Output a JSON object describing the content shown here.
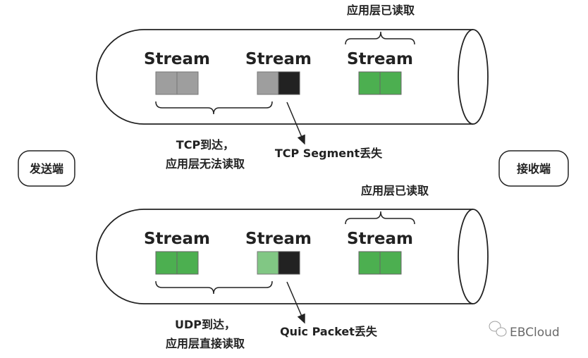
{
  "colors": {
    "gray": "#9e9e9e",
    "black": "#222222",
    "green": "#4caf50",
    "light_green": "#81c784",
    "outline": "#222222"
  },
  "sender": "发送端",
  "receiver": "接收端",
  "tcp": {
    "streams": [
      "Stream",
      "Stream",
      "Stream"
    ],
    "read_label": "应用层已读取",
    "arrived_line1": "TCP到达，",
    "arrived_line2": "应用层无法读取",
    "lost_label": "TCP Segment丢失"
  },
  "quic": {
    "streams": [
      "Stream",
      "Stream",
      "Stream"
    ],
    "read_label": "应用层已读取",
    "arrived_line1": "UDP到达，",
    "arrived_line2": "应用层直接读取",
    "lost_label": "Quic Packet丢失"
  },
  "watermark": {
    "icon": "wechat-icon",
    "text": "EBCloud"
  }
}
